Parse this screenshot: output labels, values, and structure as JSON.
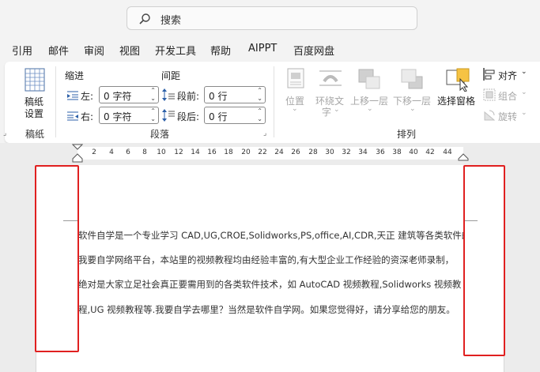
{
  "search": {
    "placeholder": "搜索"
  },
  "menu_tabs": [
    "引用",
    "邮件",
    "审阅",
    "视图",
    "开发工具",
    "帮助",
    "AIPPT",
    "百度网盘"
  ],
  "ribbon": {
    "manuscript": {
      "button_line1": "稿纸",
      "button_line2": "设置",
      "group_label": "稿纸"
    },
    "paragraph": {
      "indent_header": "缩进",
      "spacing_header": "间距",
      "left_label": "左:",
      "left_value": "0 字符",
      "right_label": "右:",
      "right_value": "0 字符",
      "before_label": "段前:",
      "before_value": "0 行",
      "after_label": "段后:",
      "after_value": "0 行",
      "group_label": "段落"
    },
    "arrange": {
      "position": "位置",
      "wrap_line1": "环绕文",
      "wrap_line2": "字",
      "bring_forward": "上移一层",
      "send_backward": "下移一层",
      "selection_pane": "选择窗格",
      "align": "对齐",
      "group": "组合",
      "rotate": "旋转",
      "group_label": "排列"
    }
  },
  "ruler": {
    "numbers": [
      "2",
      "4",
      "6",
      "8",
      "10",
      "12",
      "14",
      "16",
      "18",
      "20",
      "22",
      "24",
      "26",
      "28",
      "30",
      "32",
      "34",
      "36",
      "38",
      "40",
      "42",
      "44"
    ]
  },
  "document": {
    "lines": [
      "软件自学是一个专业学习  CAD,UG,CROE,Solidworks,PS,office,AI,CDR,天正  建筑等各类软件的",
      "我要自学网络平台，本站里的视频教程均由经验丰富的,有大型企业工作经验的资深老师录制，",
      "绝对是大家立足社会真正要需用到的各类软件技术，如 AutoCAD 视频教程,Solidworks 视频教",
      "程,UG 视频教程等.我要自学去哪里？当然是软件自学网。如果您觉得好，请分享给您的朋友。"
    ]
  },
  "colors": {
    "highlight": "#e02020",
    "selection_pane_icon": "#f6c343"
  }
}
